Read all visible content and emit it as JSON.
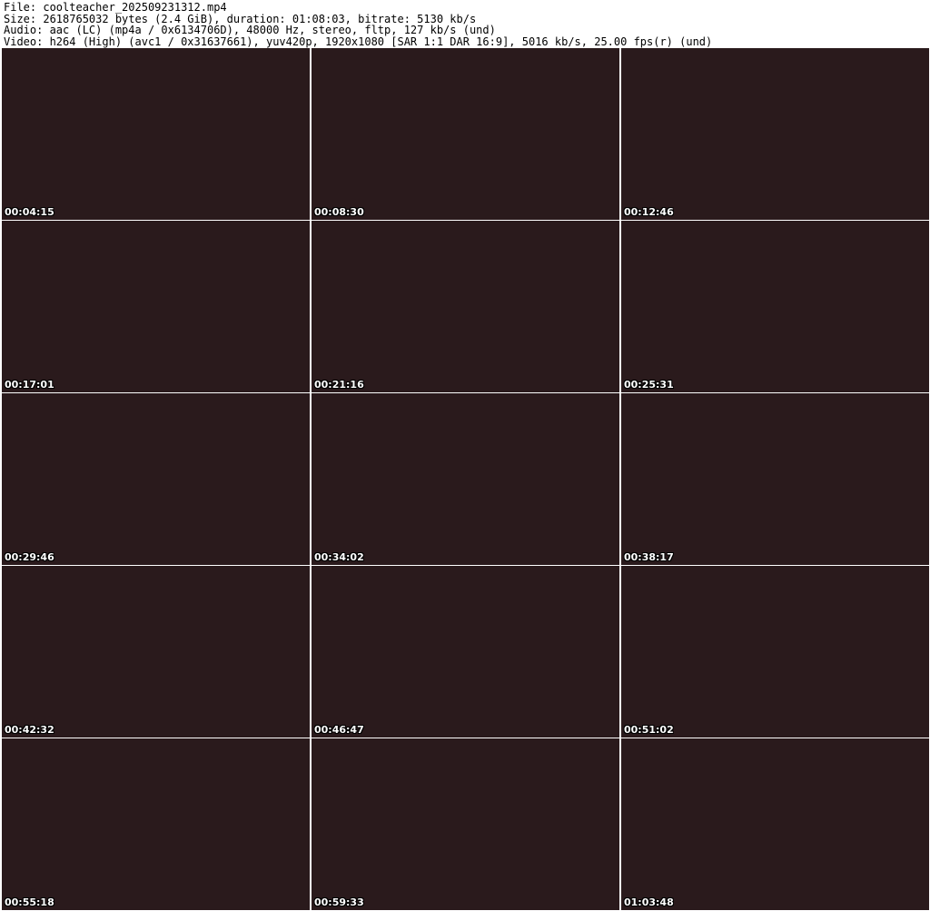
{
  "header": {
    "file": "File: coolteacher_202509231312.mp4",
    "size": "Size: 2618765032 bytes (2.4 GiB), duration: 01:08:03, bitrate: 5130 kb/s",
    "audio": "Audio: aac (LC) (mp4a / 0x6134706D), 48000 Hz, stereo, fltp, 127 kb/s (und)",
    "video": "Video: h264 (High) (avc1 / 0x31637661), yuv420p, 1920x1080 [SAR 1:1 DAR 16:9], 5016 kb/s, 25.00 fps(r) (und)"
  },
  "thumbnails": [
    {
      "timestamp": "00:04:15"
    },
    {
      "timestamp": "00:08:30"
    },
    {
      "timestamp": "00:12:46"
    },
    {
      "timestamp": "00:17:01"
    },
    {
      "timestamp": "00:21:16"
    },
    {
      "timestamp": "00:25:31"
    },
    {
      "timestamp": "00:29:46"
    },
    {
      "timestamp": "00:34:02"
    },
    {
      "timestamp": "00:38:17"
    },
    {
      "timestamp": "00:42:32"
    },
    {
      "timestamp": "00:46:47"
    },
    {
      "timestamp": "00:51:02"
    },
    {
      "timestamp": "00:55:18"
    },
    {
      "timestamp": "00:59:33"
    },
    {
      "timestamp": "01:03:48"
    }
  ]
}
